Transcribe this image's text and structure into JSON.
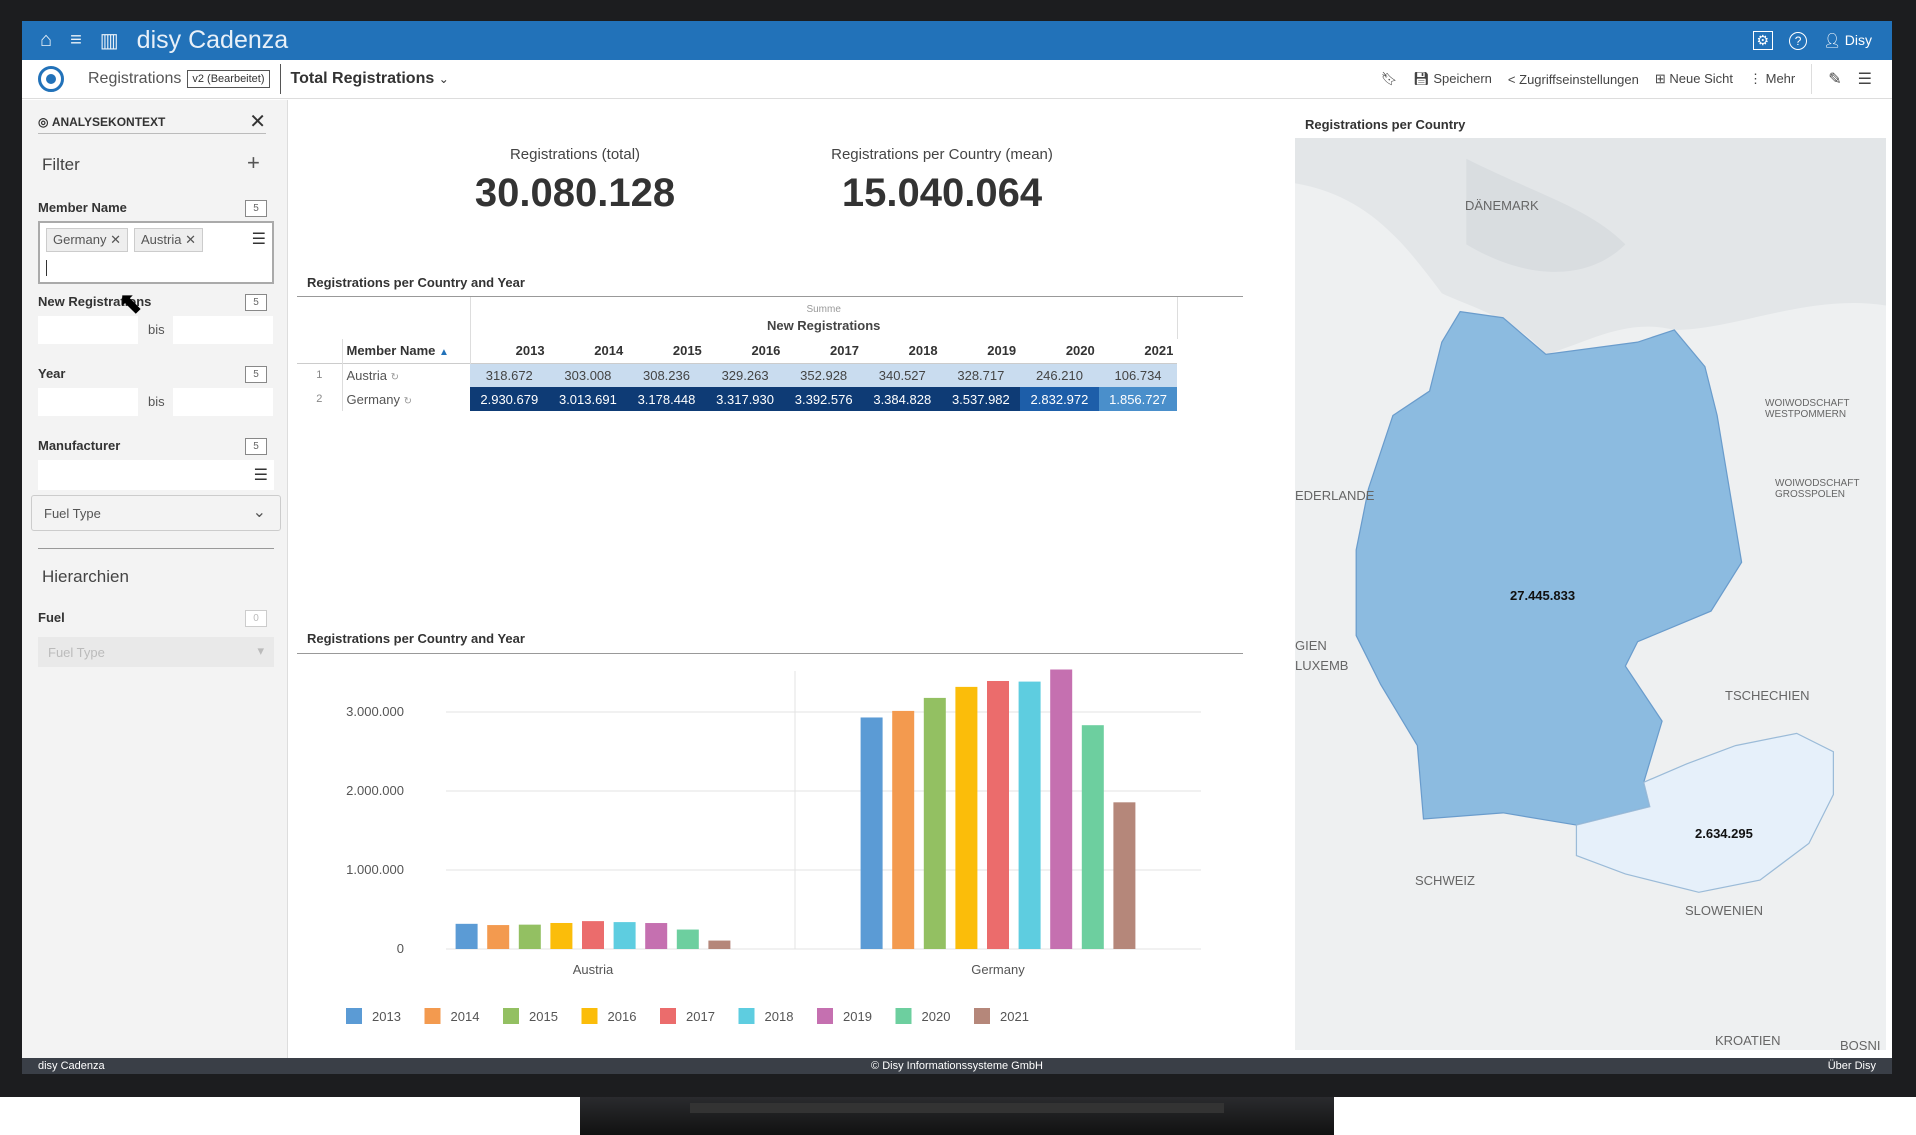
{
  "header": {
    "app_title": "disy Cadenza",
    "user": "Disy"
  },
  "toolbar": {
    "workbook": "Registrations",
    "version": "v2 (Bearbeitet)",
    "view": "Total Registrations",
    "save": "Speichern",
    "access": "Zugriffseinstellungen",
    "new_view": "Neue Sicht",
    "more": "Mehr"
  },
  "sidebar": {
    "title": "ANALYSEKONTEXT",
    "filter_heading": "Filter",
    "filters": [
      {
        "label": "Member Name",
        "count": "5",
        "chips": [
          "Germany",
          "Austria"
        ]
      },
      {
        "label": "New Registrations",
        "count": "5",
        "range_sep": "bis"
      },
      {
        "label": "Year",
        "count": "5",
        "range_sep": "bis"
      },
      {
        "label": "Manufacturer",
        "count": "5"
      }
    ],
    "fuel_type_dropdown": "Fuel Type",
    "hierarchies_heading": "Hierarchien",
    "hierarchy": {
      "label": "Fuel",
      "count": "0",
      "placeholder": "Fuel Type"
    }
  },
  "kpis": [
    {
      "label": "Registrations (total)",
      "value": "30.080.128"
    },
    {
      "label": "Registrations per Country (mean)",
      "value": "15.040.064"
    }
  ],
  "table": {
    "title": "Registrations per Country and Year",
    "agg": "Summe",
    "measure": "New Registrations",
    "dim_header": "Member Name",
    "years": [
      "2013",
      "2014",
      "2015",
      "2016",
      "2017",
      "2018",
      "2019",
      "2020",
      "2021"
    ],
    "rows": [
      {
        "idx": "1",
        "name": "Austria",
        "values": [
          "318.672",
          "303.008",
          "308.236",
          "329.263",
          "352.928",
          "340.527",
          "328.717",
          "246.210",
          "106.734"
        ]
      },
      {
        "idx": "2",
        "name": "Germany",
        "values": [
          "2.930.679",
          "3.013.691",
          "3.178.448",
          "3.317.930",
          "3.392.576",
          "3.384.828",
          "3.537.982",
          "2.832.972",
          "1.856.727"
        ]
      }
    ]
  },
  "chart_data": {
    "type": "bar",
    "title": "Registrations per Country and Year",
    "categories": [
      "Austria",
      "Germany"
    ],
    "ylim": [
      0,
      3600000
    ],
    "yticks": [
      "0",
      "1.000.000",
      "2.000.000",
      "3.000.000"
    ],
    "ytick_values": [
      0,
      1000000,
      2000000,
      3000000
    ],
    "grid": true,
    "legend": "bottom-left",
    "series": [
      {
        "name": "2013",
        "color": "#5b9bd5",
        "values": [
          318672,
          2930679
        ]
      },
      {
        "name": "2014",
        "color": "#f39a4f",
        "values": [
          303008,
          3013691
        ]
      },
      {
        "name": "2015",
        "color": "#93c062",
        "values": [
          308236,
          3178448
        ]
      },
      {
        "name": "2016",
        "color": "#fbbd0a",
        "values": [
          329263,
          3317930
        ]
      },
      {
        "name": "2017",
        "color": "#eb6c6c",
        "values": [
          352928,
          3392576
        ]
      },
      {
        "name": "2018",
        "color": "#5ecde0",
        "values": [
          340527,
          3384828
        ]
      },
      {
        "name": "2019",
        "color": "#c570b0",
        "values": [
          328717,
          3537982
        ]
      },
      {
        "name": "2020",
        "color": "#6dcf9f",
        "values": [
          246210,
          2832972
        ]
      },
      {
        "name": "2021",
        "color": "#b5877a",
        "values": [
          106734,
          1856727
        ]
      }
    ]
  },
  "map": {
    "title": "Registrations per Country",
    "germany_value": "27.445.833",
    "austria_value": "2.634.295",
    "places": [
      "DÄNEMARK",
      "EDERLANDE",
      "SCHWEIZ",
      "TSCHECHIEN",
      "SLOWENIEN",
      "KROATIEN",
      "WOIWODSCHAFT WESTPOMMERN",
      "WOIWODSCHAFT GROSSPOLEN",
      "LUXEMB",
      "GIEN",
      "BOSNI"
    ]
  },
  "footer": {
    "left": "disy Cadenza",
    "center": "© Disy Informationssysteme GmbH",
    "right": "Über Disy"
  }
}
